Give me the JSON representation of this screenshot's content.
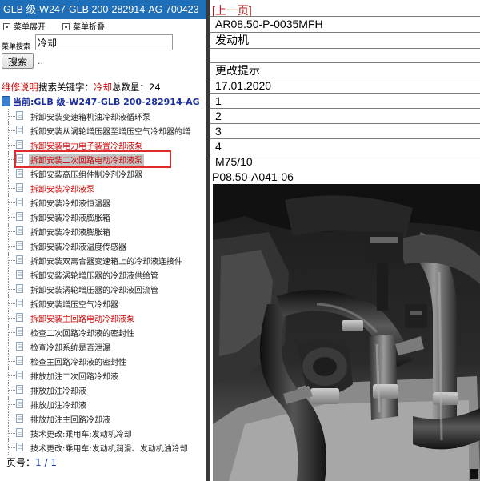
{
  "left_pane": {
    "title": "GLB 级-W247-GLB 200-282914-AG 700423",
    "expand_menu": "菜单展开",
    "collapse_menu": "菜单折叠",
    "search_label": "菜单搜索",
    "search_value": "冷却",
    "search_button": "搜索",
    "search_hint": "..",
    "result_prefix": "维修说明",
    "result_keyword_label": "搜索关键字：",
    "result_keyword": "冷却",
    "result_count_label": "总数量：",
    "result_count": "24",
    "tree_root": "当前:GLB 级-W247-GLB 200-282914-AG",
    "items": [
      {
        "label": "拆卸安装变速箱机油冷却液循环泵",
        "red": false
      },
      {
        "label": "拆卸安装从涡轮增压器至增压空气冷却器的增",
        "red": false
      },
      {
        "label": "拆卸安装电力电子装置冷却液泵",
        "red": true
      },
      {
        "label": "拆卸安装二次回路电动冷却液泵",
        "red": true
      },
      {
        "label": "拆卸安装高压组件制冷剂冷却器",
        "red": false
      },
      {
        "label": "拆卸安装冷却液泵",
        "red": true
      },
      {
        "label": "拆卸安装冷却液恒温器",
        "red": false
      },
      {
        "label": "拆卸安装冷却液膨胀箱",
        "red": false
      },
      {
        "label": "拆卸安装冷却液膨胀箱",
        "red": false
      },
      {
        "label": "拆卸安装冷却液温度传感器",
        "red": false
      },
      {
        "label": "拆卸安装双离合器变速箱上的冷却液连接件",
        "red": false
      },
      {
        "label": "拆卸安装涡轮增压器的冷却液供给管",
        "red": false
      },
      {
        "label": "拆卸安装涡轮增压器的冷却液回流管",
        "red": false
      },
      {
        "label": "拆卸安装增压空气冷却器",
        "red": false
      },
      {
        "label": "拆卸安装主回路电动冷却液泵",
        "red": true
      },
      {
        "label": "检查二次回路冷却液的密封性",
        "red": false
      },
      {
        "label": "检查冷却系统是否泄漏",
        "red": false
      },
      {
        "label": "检查主回路冷却液的密封性",
        "red": false
      },
      {
        "label": "排放加注二次回路冷却液",
        "red": false
      },
      {
        "label": "排放加注冷却液",
        "red": false
      },
      {
        "label": "排放加注冷却液",
        "red": false
      },
      {
        "label": "排放加注主回路冷却液",
        "red": false
      },
      {
        "label": "技术更改:乘用车:发动机冷却",
        "red": false
      },
      {
        "label": "技术更改:乘用车:发动机润滑、发动机油冷却",
        "red": false
      }
    ],
    "pager_label": "页号：",
    "pager_value": "1 / 1"
  },
  "right_pane": {
    "prev_link": "[上一页]",
    "rows": [
      "AR08.50-P-0035MFH",
      "发动机",
      "",
      "更改提示",
      "17.01.2020",
      "1",
      "2",
      "3",
      "4",
      "M75/10"
    ],
    "image_label": "P08.50-A041-06"
  },
  "colors": {
    "title_bar": "#1e6fb8",
    "highlight_red": "#d00000",
    "selection_box": "#e02a2a",
    "link_blue": "#1a2ea0"
  }
}
